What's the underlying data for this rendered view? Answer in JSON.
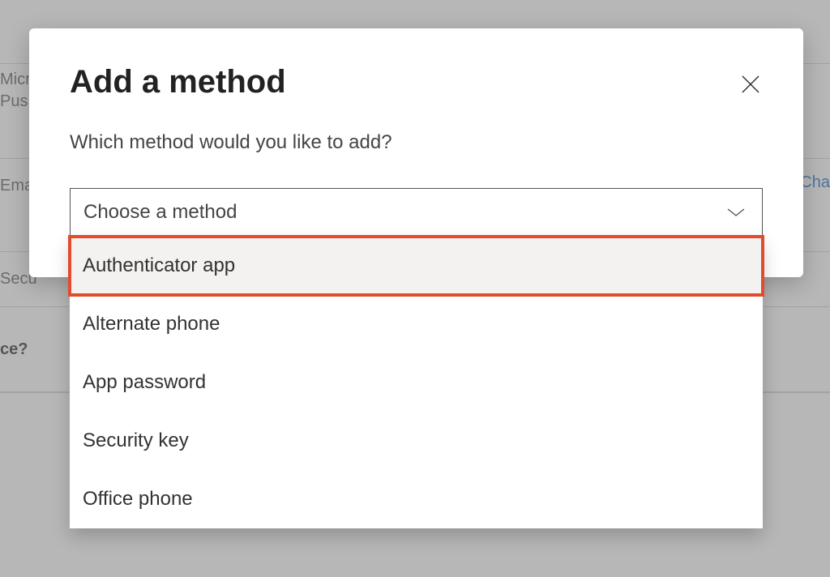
{
  "background": {
    "row1_text1": "Micr",
    "row1_text2": "Pus",
    "row2_text": "Ema",
    "row2_action": "Cha",
    "row3_text": "Secu",
    "row4_text": "ce?"
  },
  "dialog": {
    "title": "Add a method",
    "subtitle": "Which method would you like to add?",
    "select_placeholder": "Choose a method",
    "options": {
      "opt0": "Authenticator app",
      "opt1": "Alternate phone",
      "opt2": "App password",
      "opt3": "Security key",
      "opt4": "Office phone"
    },
    "highlighted_index": 0
  }
}
